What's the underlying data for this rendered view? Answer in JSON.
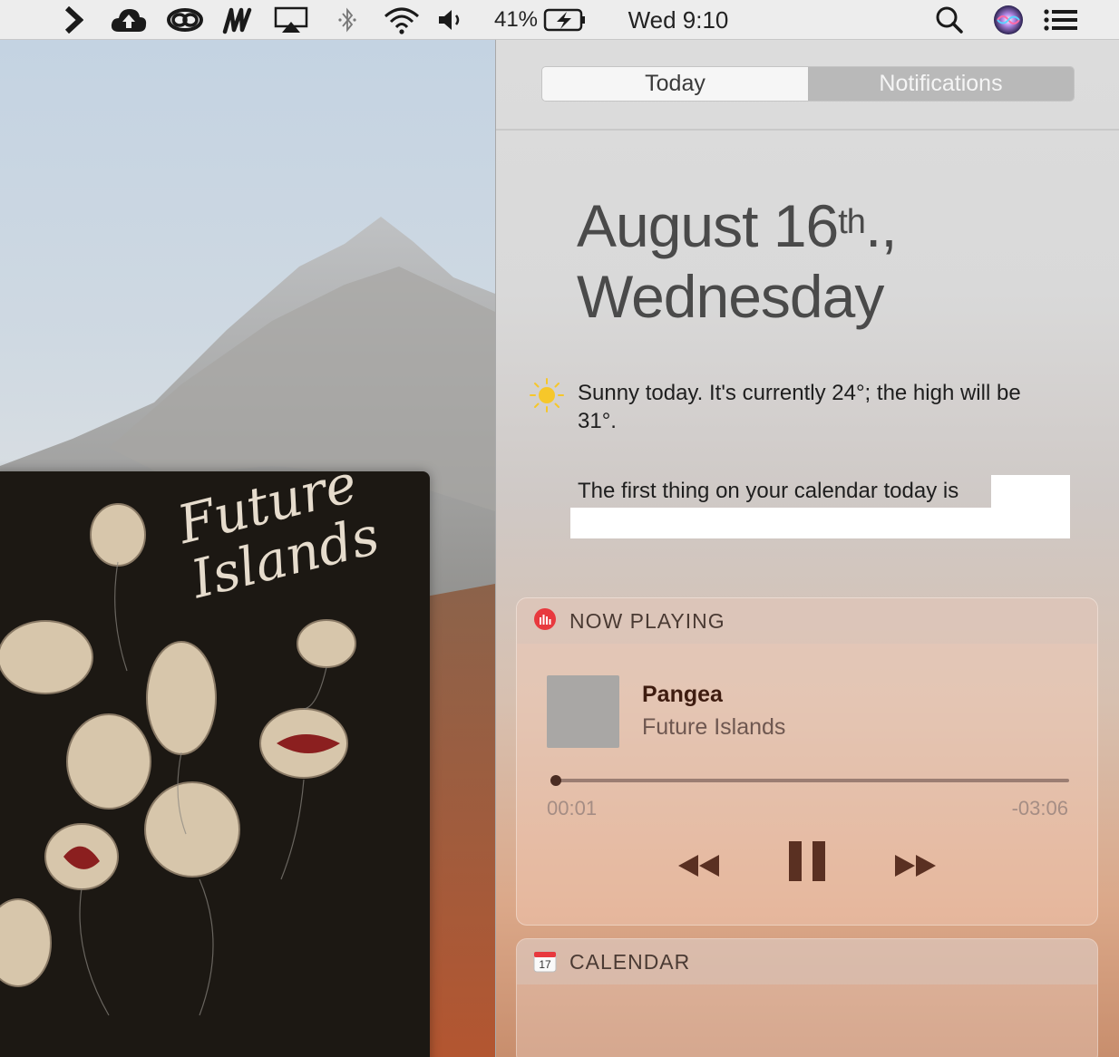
{
  "menubar": {
    "battery_text": "41%",
    "clock": "Wed 9:10",
    "icons": [
      "chevron-right-icon",
      "cloud-upload-icon",
      "creative-cloud-icon",
      "m-app-icon",
      "airplay-icon",
      "bluetooth-icon",
      "wifi-icon",
      "volume-icon",
      "battery-charging-icon",
      "spotlight-search-icon",
      "siri-icon",
      "notification-center-icon"
    ]
  },
  "desktop": {
    "album_title": "Future Islands"
  },
  "panel": {
    "tabs": [
      {
        "label": "Today",
        "active": true
      },
      {
        "label": "Notifications",
        "active": false
      }
    ],
    "date_line1": "August 16",
    "date_suffix": "th",
    "date_punct": ".,",
    "date_line2": "Wednesday",
    "weather_text": "Sunny today. It's currently 24°; the high will be 31°.",
    "calendar_text": "The first thing on your calendar today is"
  },
  "now_playing": {
    "title": "NOW PLAYING",
    "track": "Pangea",
    "artist": "Future Islands",
    "elapsed": "00:01",
    "remaining": "-03:06",
    "progress_fraction": 0.005
  },
  "calendar_widget": {
    "title": "CALENDAR",
    "icon_day": "17"
  },
  "colors": {
    "accent_red": "#e8393e",
    "control_brown": "#5a3022"
  }
}
